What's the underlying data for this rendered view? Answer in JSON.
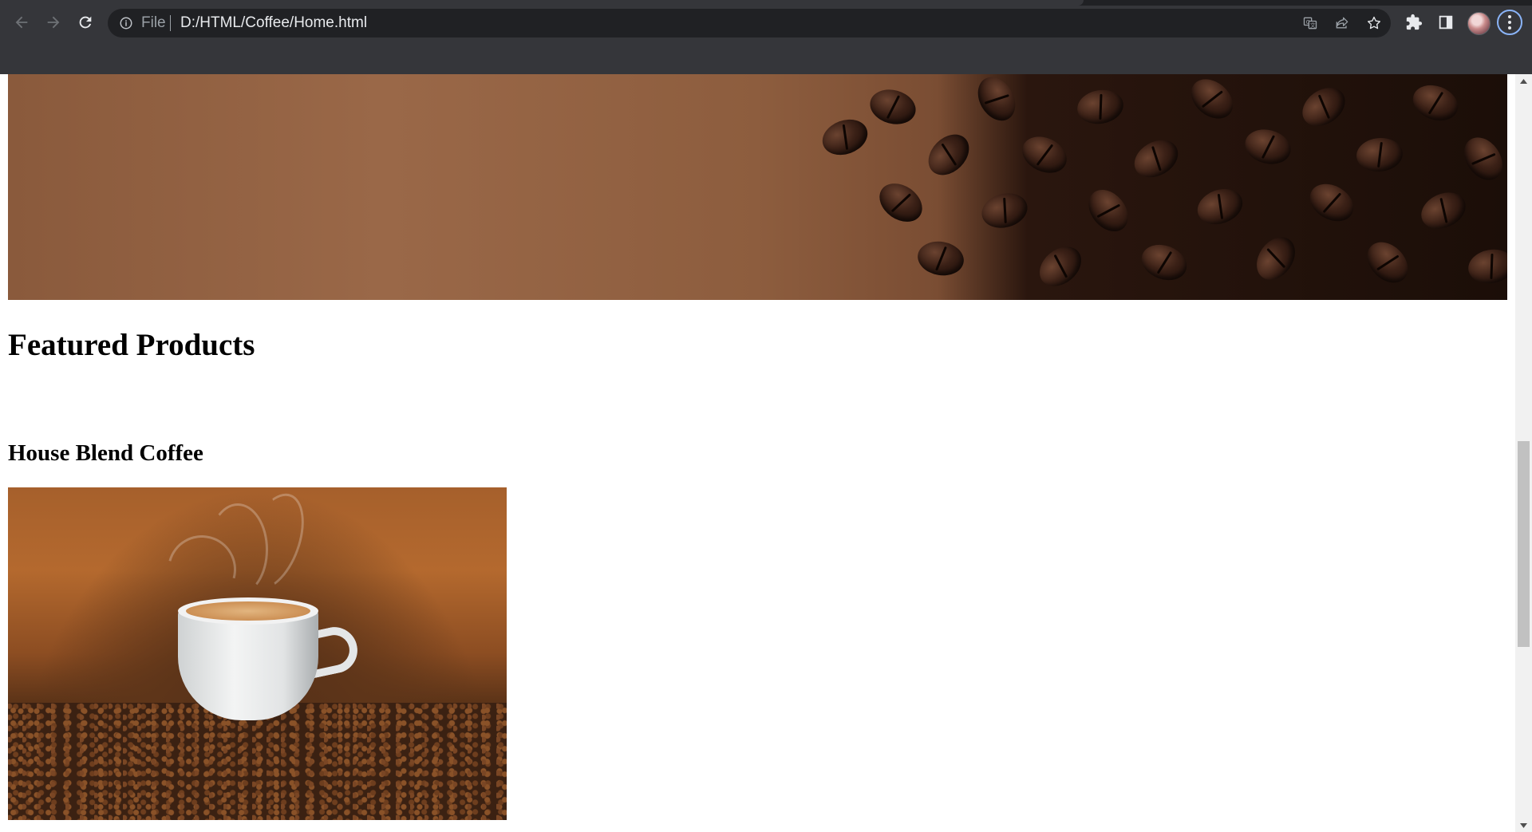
{
  "browser": {
    "omnibox": {
      "scheme_label": "File",
      "url": "D:/HTML/Coffee/Home.html"
    },
    "icons": {
      "back": "arrow-left-icon",
      "forward": "arrow-right-icon",
      "reload": "reload-icon",
      "site_info": "info-icon",
      "translate": "translate-icon",
      "share": "share-icon",
      "bookmark": "star-icon",
      "extensions": "puzzle-icon",
      "side_panel": "side-panel-icon",
      "menu": "kebab-menu-icon"
    },
    "colors": {
      "chrome_bg": "#35363a",
      "omnibox_bg": "#202124",
      "accent": "#8ab4f8"
    }
  },
  "page": {
    "hero": {
      "image": "coffee-beans-banner"
    },
    "section_title": "Featured Products",
    "products": [
      {
        "name": "House Blend Coffee",
        "image": "coffee-cup-on-beans"
      }
    ]
  }
}
